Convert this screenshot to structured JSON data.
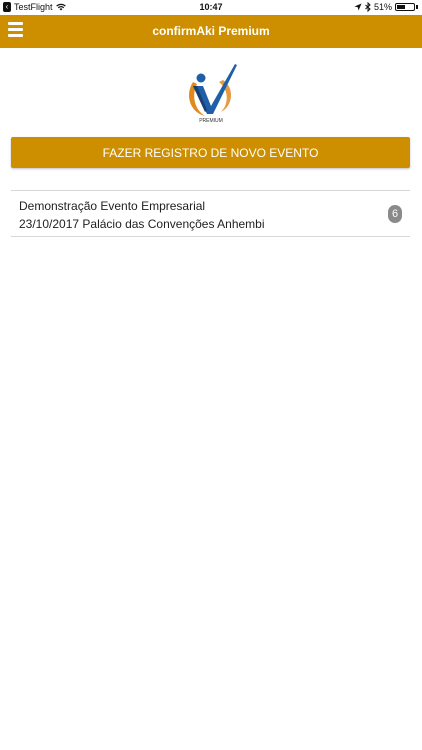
{
  "status_bar": {
    "carrier": "TestFlight",
    "time": "10:47",
    "battery": "51%",
    "battery_level": 0.51
  },
  "navbar": {
    "title": "confirmAki Premium"
  },
  "logo": {
    "text": "PREMIUM"
  },
  "primary_button": {
    "label": "FAZER REGISTRO DE NOVO EVENTO"
  },
  "events": [
    {
      "name": "Demonstração Evento Empresarial",
      "details": "23/10/2017 Palácio das Convenções Anhembi",
      "count": "6"
    }
  ],
  "colors": {
    "accent": "#cd8f00",
    "badge": "#8a8a8a"
  }
}
